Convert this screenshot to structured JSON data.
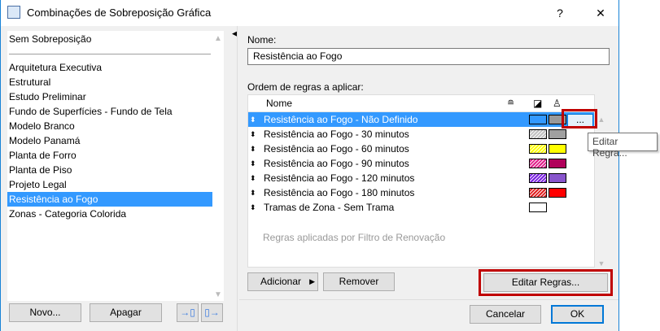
{
  "window": {
    "title": "Combinações de Sobreposição Gráfica",
    "help": "?",
    "close": "✕"
  },
  "list": {
    "items": [
      "Sem Sobreposição",
      "Arquitetura Executiva",
      "Estrutural",
      "Estudo Preliminar",
      "Fundo de Superfícies - Fundo de Tela",
      "Modelo Branco",
      "Modelo Panamá",
      "Planta de Forro",
      "Planta de Piso",
      "Projeto Legal",
      "Resistência ao Fogo",
      "Zonas - Categoria Colorida"
    ],
    "selected": 10
  },
  "left_buttons": {
    "new": "Novo...",
    "delete": "Apagar"
  },
  "name_label": "Nome:",
  "name_value": "Resistência ao Fogo",
  "rules_label": "Ordem de regras a aplicar:",
  "table": {
    "col_name": "Nome",
    "rows": [
      {
        "name": "Resistência ao Fogo - Não Definido",
        "fill": "#3399ff",
        "pen": "#999999",
        "hatch": false
      },
      {
        "name": "Resistência ao Fogo -  30 minutos",
        "fill": "#c0c0c0",
        "pen": "#a0a0a0",
        "hatch": true
      },
      {
        "name": "Resistência ao Fogo -  60 minutos",
        "fill": "#ffff00",
        "pen": "#ffff00",
        "hatch": true
      },
      {
        "name": "Resistência ao Fogo -  90 minutos",
        "fill": "#e0208a",
        "pen": "#b0005a",
        "hatch": true
      },
      {
        "name": "Resistência ao Fogo - 120 minutos",
        "fill": "#7a20e0",
        "pen": "#8855cc",
        "hatch": true
      },
      {
        "name": "Resistência ao Fogo - 180 minutos",
        "fill": "#e02020",
        "pen": "#ff0000",
        "hatch": true
      },
      {
        "name": "Tramas de Zona - Sem Trama",
        "fill": "#ffffff",
        "pen": null,
        "hatch": false
      }
    ],
    "renovation_note": "Regras aplicadas por Filtro de Renovação",
    "edit_button": "..."
  },
  "tooltip": "Editar Regra...",
  "right_buttons": {
    "add": "Adicionar",
    "remove": "Remover",
    "edit_rules": "Editar Regras...",
    "cancel": "Cancelar",
    "ok": "OK"
  }
}
